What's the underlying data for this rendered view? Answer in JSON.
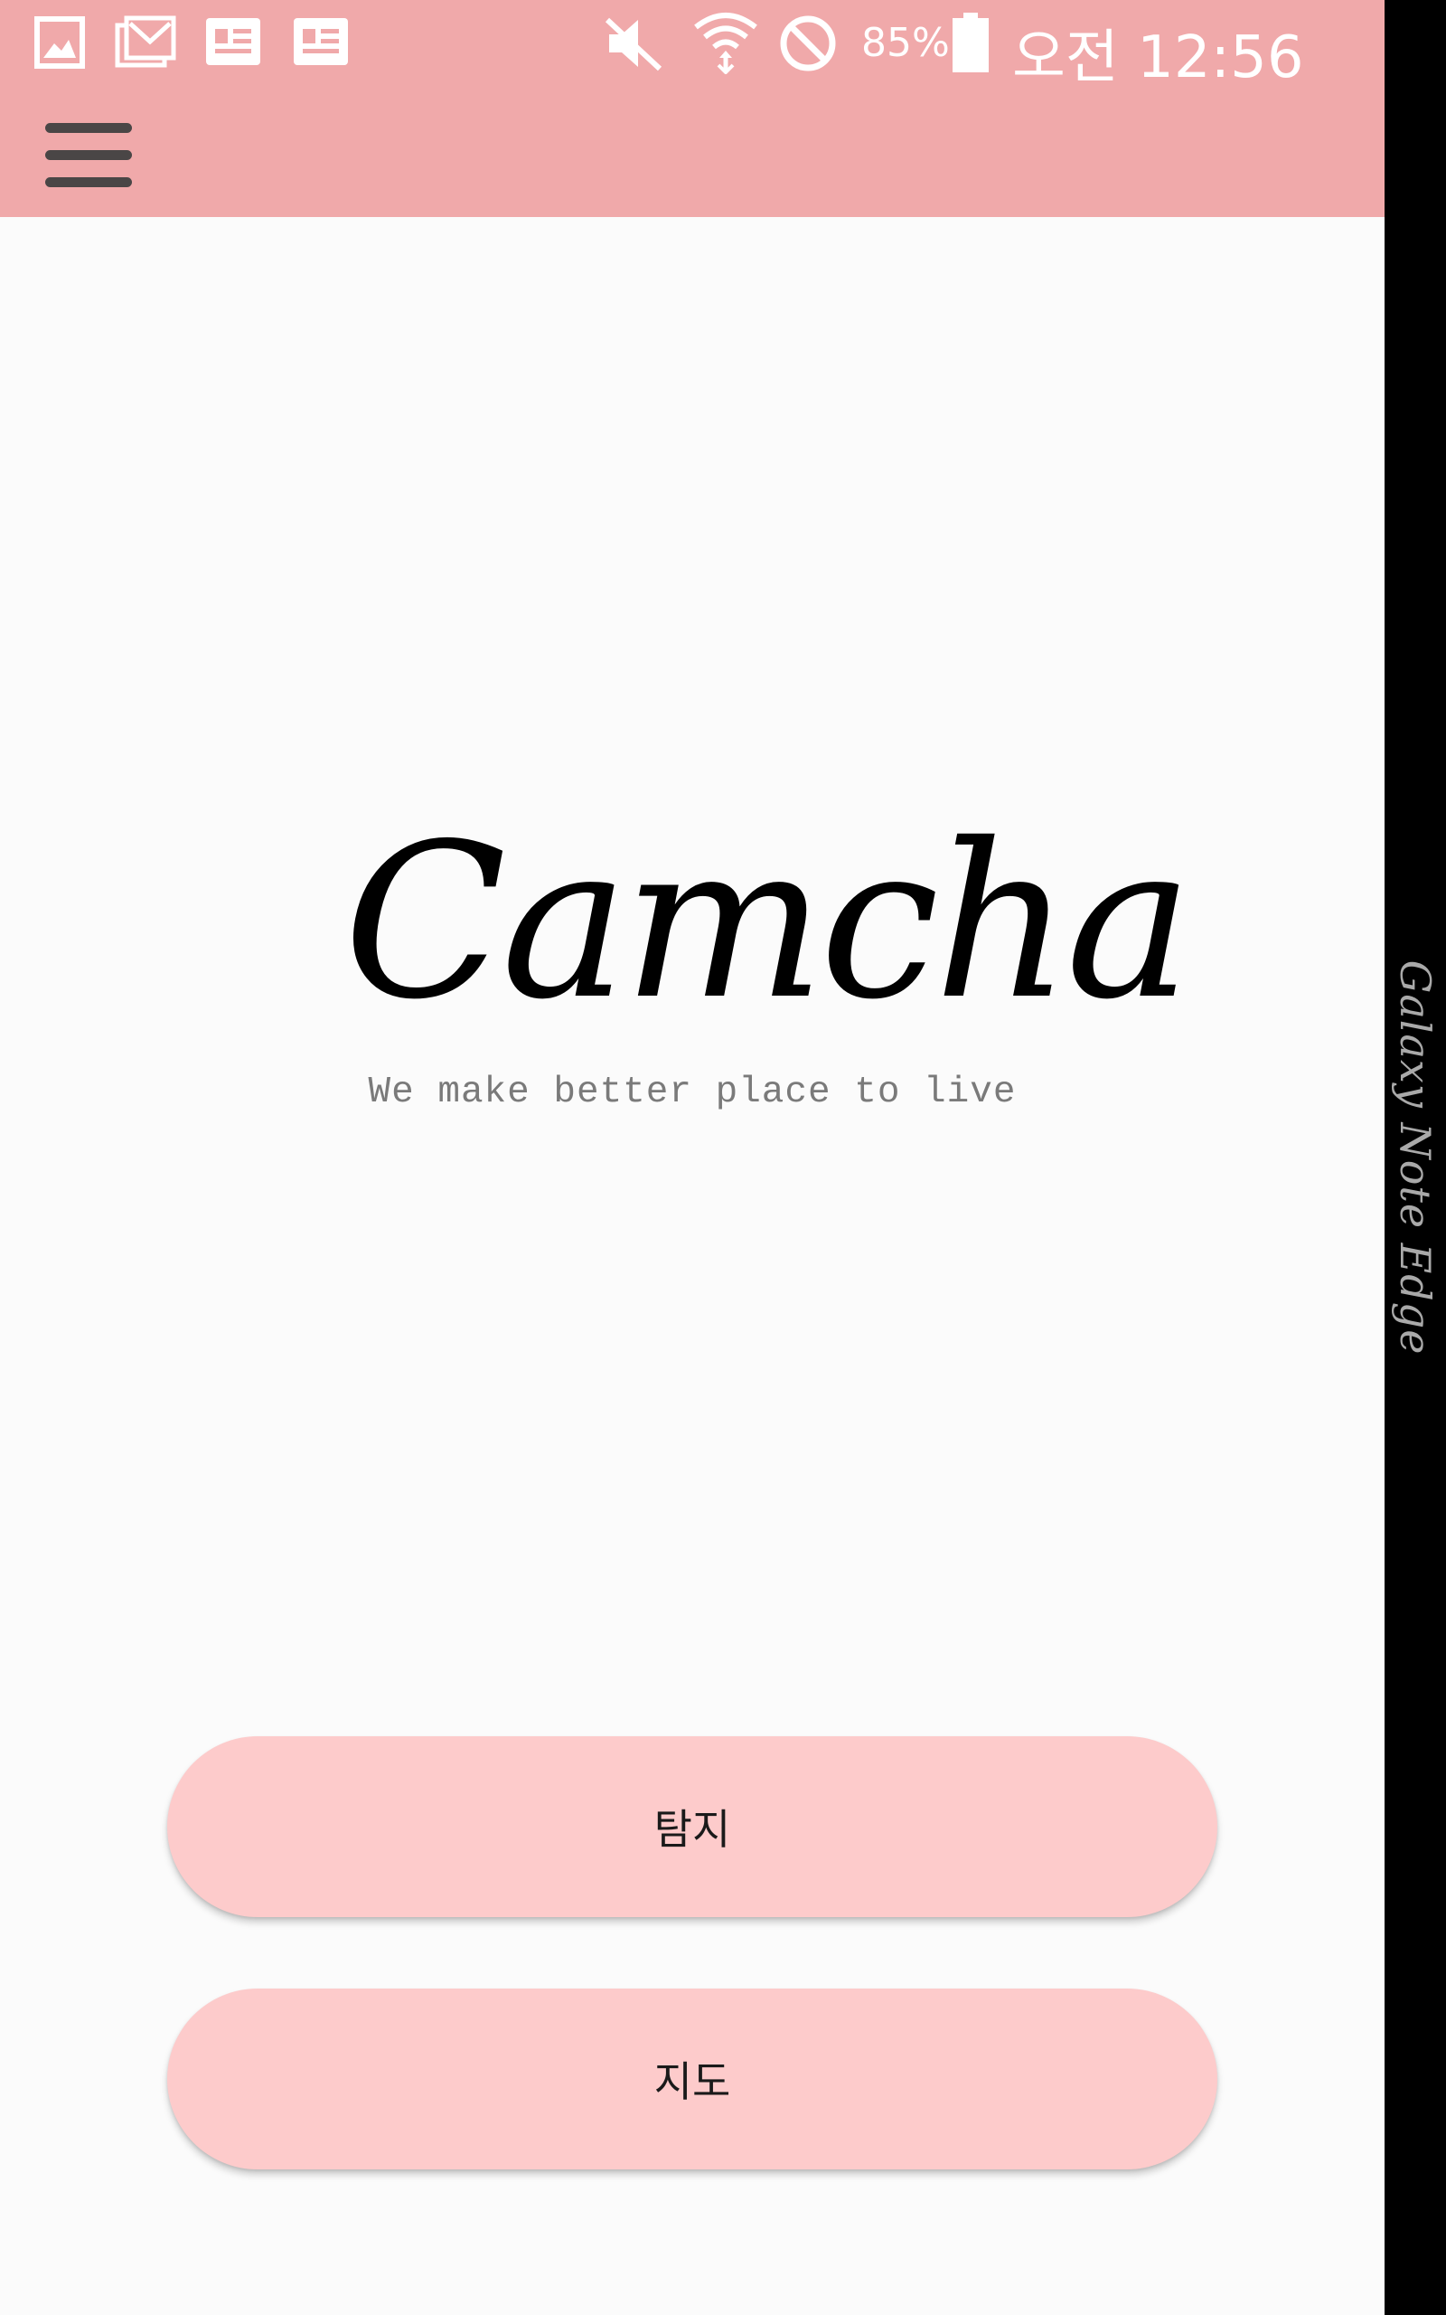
{
  "status_bar": {
    "notification_icons": [
      "gallery-icon",
      "gmail-icon",
      "news-icon",
      "news-icon"
    ],
    "system_icons": [
      "mute-icon",
      "wifi-icon",
      "do-not-disturb-icon",
      "battery-icon"
    ],
    "battery_percent": "85%",
    "time": "오전 12:56"
  },
  "app_bar": {
    "menu_icon": "hamburger-menu-icon"
  },
  "main": {
    "logo_text": "Camcha",
    "tagline": "We make better place to live"
  },
  "buttons": {
    "detect_label": "탐지",
    "map_label": "지도"
  },
  "edge_panel": {
    "label": "Galaxy Note Edge"
  },
  "colors": {
    "app_bar": "#f0a9aa",
    "button": "#fdcbcb",
    "background": "#fbfbfb",
    "edge_panel": "#000000"
  }
}
